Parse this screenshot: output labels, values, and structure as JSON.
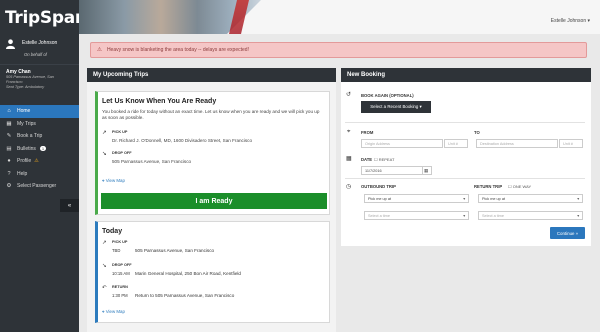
{
  "app": {
    "name": "TripSpark"
  },
  "header": {
    "user_menu": "Estelle Johnson ▾"
  },
  "sidebar": {
    "user_name": "Estelle Johnson",
    "on_behalf": "On behalf of",
    "passenger": {
      "name": "Amy Chan",
      "address_1": "505 Parnassus Avenue, San",
      "address_2": "Francisco",
      "seat_type": "Seat Type: Ambulatory"
    },
    "items": [
      {
        "label": "Home",
        "icon": "home-icon"
      },
      {
        "label": "My Trips",
        "icon": "calendar-icon"
      },
      {
        "label": "Book a Trip",
        "icon": "book-icon"
      },
      {
        "label": "Bulletins",
        "icon": "bulletin-icon",
        "badge": "1"
      },
      {
        "label": "Profile",
        "icon": "profile-icon"
      },
      {
        "label": "Help",
        "icon": "help-icon"
      },
      {
        "label": "Select Passenger",
        "icon": "passenger-icon"
      }
    ],
    "collapse": "«"
  },
  "alert": {
    "message": "Heavy snow is blanketing the area today -- delays are expected!"
  },
  "trips": {
    "title": "My Upcoming Trips",
    "card1": {
      "title": "Let Us Know When You Are Ready",
      "text": "You booked a ride for today without an exact time. Let us know when you are ready and we will pick you up as soon as possible.",
      "pickup_label": "PICK UP",
      "pickup_value": "Dr. Richard J. O'Donnell, MD, 1600 Divisadero Street, San Francisco",
      "dropoff_label": "DROP OFF",
      "dropoff_value": "505 Parnassus Avenue, San Francisco",
      "view_map": "View Map",
      "ready_button": "I am Ready"
    },
    "card2": {
      "title": "Today",
      "pickup_label": "PICK UP",
      "pickup_time": "TBD",
      "pickup_addr": "505 Parnassus Avenue, San Francisco",
      "dropoff_label": "DROP OFF",
      "dropoff_time": "10:15 AM",
      "dropoff_addr": "Marin General Hospital, 250 Bon Air Road, Kentfield",
      "return_label": "RETURN",
      "return_time": "1:30 PM",
      "return_addr": "Return to 505 Parnassus Avenue, San Francisco",
      "view_map": "View Map"
    }
  },
  "booking": {
    "title": "New Booking",
    "book_again_label": "BOOK AGAIN (OPTIONAL)",
    "recent_button": "Select a Recent Booking ▾",
    "from_label": "FROM",
    "to_label": "TO",
    "origin_placeholder": "Origin Address",
    "unit_placeholder": "Unit #",
    "destination_placeholder": "Destination Address",
    "date_label": "DATE",
    "repeat_label": "REPEAT",
    "date_value": "11/7/2016",
    "outbound_label": "OUTBOUND TRIP",
    "return_label": "RETURN TRIP",
    "one_way_label": "ONE WAY",
    "outbound_select": "Pick me up at",
    "return_select": "Pick me up at",
    "outbound_time": "Select a time",
    "return_time": "Select a time",
    "continue_button": "Continue »"
  }
}
